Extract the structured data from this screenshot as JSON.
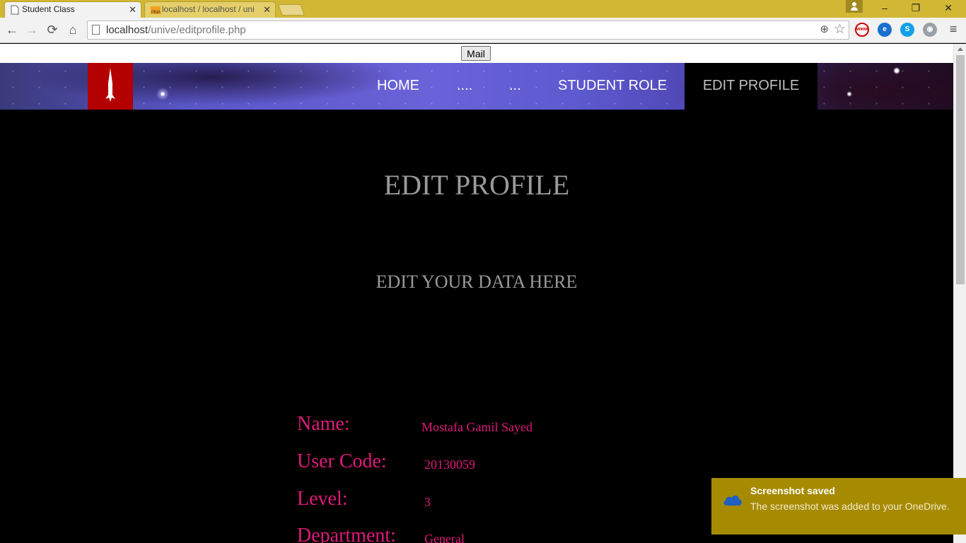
{
  "browser": {
    "tabs": [
      {
        "title": "Student Class",
        "active": true
      },
      {
        "title": "localhost / localhost / uni",
        "active": false
      }
    ],
    "tab_close_glyph": "✕",
    "url_host": "localhost",
    "url_path": "/unive/editprofile.php",
    "window_controls": {
      "minimize": "–",
      "restore": "❐",
      "close": "✕"
    },
    "icons": [
      "back-icon",
      "forward-icon",
      "reload-icon",
      "home-icon",
      "zoom-icon",
      "star-icon",
      "menu-icon"
    ]
  },
  "page": {
    "mail_button": "Mail",
    "nav": [
      {
        "label": "HOME"
      },
      {
        "label": "...."
      },
      {
        "label": "..."
      },
      {
        "label": "STUDENT ROLE"
      },
      {
        "label": "EDIT PROFILE",
        "active": true
      }
    ],
    "heading": "EDIT PROFILE",
    "subheading": "EDIT YOUR DATA HERE",
    "fields": [
      {
        "label": "Name:",
        "value": "Mostafa Gamil Sayed"
      },
      {
        "label": "User Code:",
        "value": "20130059"
      },
      {
        "label": "Level:",
        "value": "3"
      },
      {
        "label": "Department:",
        "value": "General"
      }
    ],
    "colors": {
      "field_text": "#e0197a",
      "logo_bg": "#b30000",
      "heading": "#9a9a9a"
    }
  },
  "notification": {
    "title": "Screenshot saved",
    "body": "The screenshot was added to your OneDrive.",
    "icon": "onedrive-cloud-icon",
    "color": "#a68b00"
  }
}
